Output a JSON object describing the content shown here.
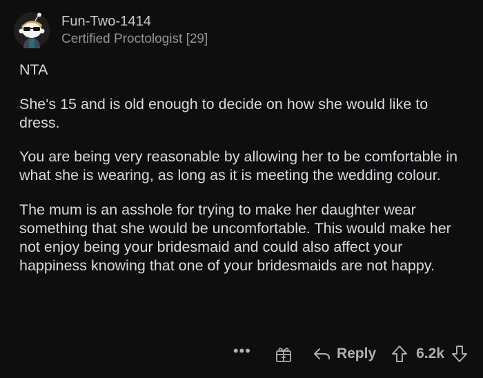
{
  "comment": {
    "author": {
      "username": "Fun-Two-1414",
      "flair": "Certified Proctologist [29]"
    },
    "paragraphs": [
      "NTA",
      "She's 15 and is old enough to decide on how she would like to dress.",
      "You are being very reasonable by allowing her to be comfortable in what she is wearing, as long as it is meeting the wedding colour.",
      "The mum is an asshole for trying to make her daughter wear something that she would be uncomfortable. This would make her not enjoy being your bridesmaid and could also affect your happiness knowing that one of your bridesmaids are not happy."
    ],
    "actions": {
      "more_label": "•••",
      "reply_label": "Reply",
      "score": "6.2k"
    }
  },
  "colors": {
    "background": "#0e0e0f",
    "text": "#d7dadc",
    "muted": "#8f9396",
    "action": "#aeb1b4"
  },
  "icons": {
    "avatar": "snoo-avatar-icon",
    "award": "gift-award-icon",
    "reply": "reply-arrow-icon",
    "upvote": "upvote-arrow-icon",
    "downvote": "downvote-arrow-icon"
  }
}
